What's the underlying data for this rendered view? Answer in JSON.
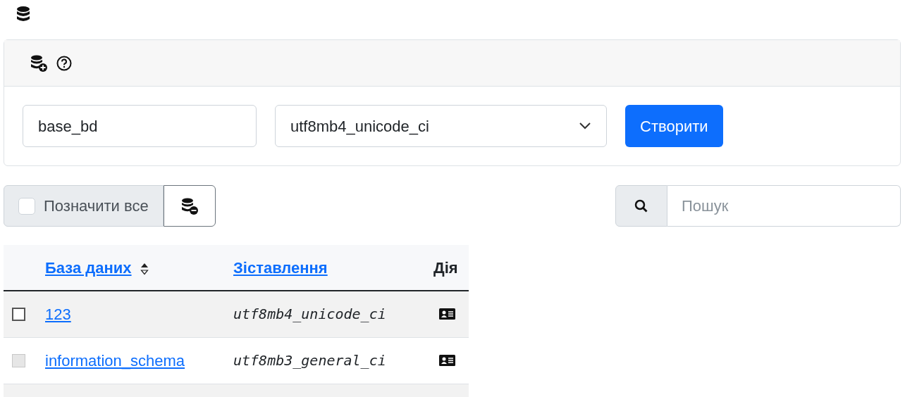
{
  "create_form": {
    "name_field": {
      "value": "base_bd"
    },
    "collation_select": {
      "value": "utf8mb4_unicode_ci"
    },
    "create_button": "Створити"
  },
  "toolbar": {
    "select_all": {
      "label": "Позначити все",
      "checked": false
    },
    "search": {
      "placeholder": "Пошук"
    }
  },
  "table": {
    "columns": [
      "База даних",
      "Зіставлення",
      "Дія"
    ],
    "rows": [
      {
        "name": "123",
        "collation": "utf8mb4_unicode_ci",
        "checked": false,
        "disabled": false
      },
      {
        "name": "information_schema",
        "collation": "utf8mb3_general_ci",
        "checked": false,
        "disabled": true
      }
    ]
  }
}
